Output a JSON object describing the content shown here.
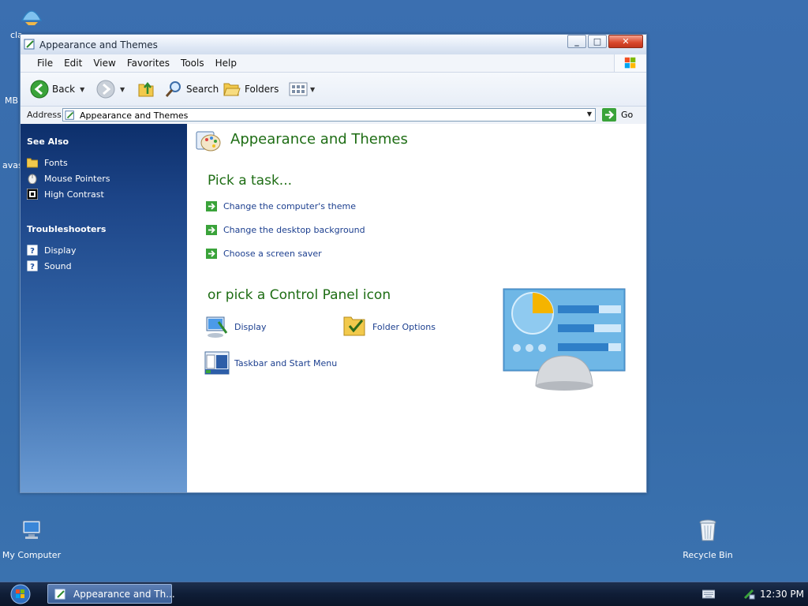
{
  "desktop": {
    "partials": [
      "cla",
      "MB",
      "avas"
    ],
    "icons": {
      "my_computer": "My Computer",
      "recycle_bin": "Recycle Bin"
    }
  },
  "window": {
    "title": "Appearance and Themes",
    "menu": [
      "File",
      "Edit",
      "View",
      "Favorites",
      "Tools",
      "Help"
    ],
    "toolbar": {
      "back": "Back",
      "search": "Search",
      "folders": "Folders"
    },
    "address": {
      "label": "Address",
      "value": "Appearance and Themes",
      "go": "Go"
    },
    "sidebar": {
      "see_also_title": "See Also",
      "see_also": [
        "Fonts",
        "Mouse Pointers",
        "High Contrast"
      ],
      "troubleshooters_title": "Troubleshooters",
      "troubleshooters": [
        "Display",
        "Sound"
      ]
    },
    "main": {
      "header": "Appearance and Themes",
      "pick_task": "Pick a task...",
      "tasks": [
        "Change the computer's theme",
        "Change the desktop background",
        "Choose a screen saver"
      ],
      "pick_icon": "or pick a Control Panel icon",
      "icons": [
        "Display",
        "Folder Options",
        "Taskbar and Start Menu"
      ]
    }
  },
  "taskbar": {
    "task_label": "Appearance and Th...",
    "clock": "12:30 PM"
  }
}
